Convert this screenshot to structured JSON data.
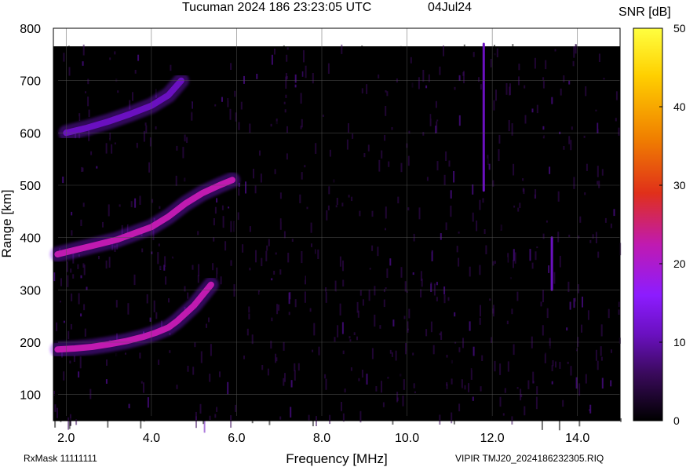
{
  "header": {
    "title": "Tucuman 2024 186 23:23:05 UTC",
    "date": "04Jul24"
  },
  "footer": {
    "rxmask": "RxMask 11111111",
    "file": "VIPIR  TMJ20_2024186232305.RIQ"
  },
  "colorbar": {
    "label": "SNR [dB]",
    "ticks": [
      "0",
      "10",
      "20",
      "30",
      "40",
      "50"
    ]
  },
  "chart_data": {
    "type": "heatmap",
    "title": "Tucuman 2024 186 23:23:05 UTC",
    "xlabel": "Frequency [MHz]",
    "ylabel": "Range [km]",
    "xlim": [
      1.7,
      15.0
    ],
    "ylim": [
      50,
      800
    ],
    "xticks": [
      2.0,
      4.0,
      6.0,
      8.0,
      10.0,
      12.0,
      14.0
    ],
    "xtick_labels": [
      "2.0",
      "4.0",
      "6.0",
      "8.0",
      "10.0",
      "12.0",
      "14.0"
    ],
    "yticks": [
      100,
      200,
      300,
      400,
      500,
      600,
      700,
      800
    ],
    "ytick_labels": [
      "100",
      "200",
      "300",
      "400",
      "500",
      "600",
      "700",
      "800"
    ],
    "zlim": [
      0,
      50
    ],
    "zlabel": "SNR [dB]",
    "colormap": [
      "#000000",
      "#3a0a5c",
      "#6a10c0",
      "#8c1cff",
      "#c01ab0",
      "#e0301a",
      "#f08000",
      "#ffd000",
      "#ffff40"
    ],
    "grid": true,
    "traces": [
      {
        "name": "E/F1 trace",
        "freq_mhz": [
          1.8,
          2.2,
          2.6,
          3.0,
          3.4,
          3.8,
          4.1,
          4.4,
          4.6,
          4.8,
          5.0,
          5.2,
          5.4
        ],
        "range_km": [
          186,
          188,
          191,
          196,
          202,
          210,
          218,
          228,
          240,
          255,
          270,
          290,
          310
        ],
        "snr_db": 28
      },
      {
        "name": "F2 trace",
        "freq_mhz": [
          1.8,
          2.0,
          2.4,
          2.8,
          3.2,
          3.6,
          4.0,
          4.4,
          4.8,
          5.2,
          5.6,
          5.9
        ],
        "range_km": [
          368,
          372,
          380,
          388,
          396,
          408,
          420,
          440,
          465,
          485,
          500,
          510
        ],
        "snr_db": 25
      },
      {
        "name": "second-hop trace",
        "freq_mhz": [
          2.0,
          2.5,
          3.0,
          3.5,
          4.0,
          4.4,
          4.7
        ],
        "range_km": [
          600,
          610,
          622,
          636,
          652,
          672,
          700
        ],
        "snr_db": 14
      },
      {
        "name": "spur 11.8",
        "freq_mhz": [
          11.8,
          11.8
        ],
        "range_km": [
          490,
          770
        ],
        "snr_db": 12
      },
      {
        "name": "spur 13.4",
        "freq_mhz": [
          13.4,
          13.4
        ],
        "range_km": [
          300,
          400
        ],
        "snr_db": 12
      }
    ]
  }
}
